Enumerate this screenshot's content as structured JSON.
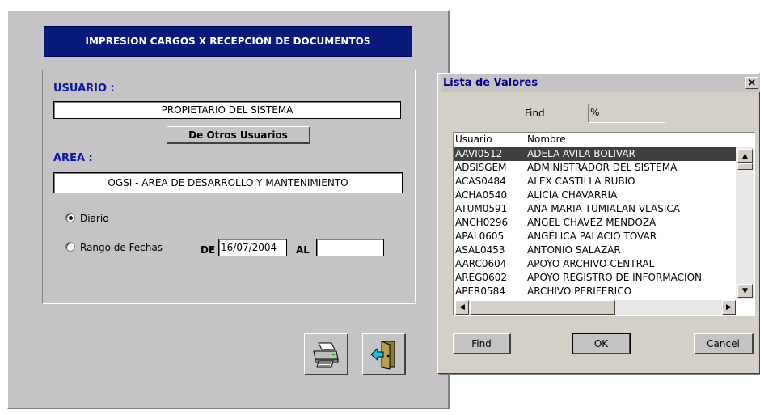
{
  "form": {
    "title": "IMPRESION CARGOS X RECEPCIÓN DE DOCUMENTOS",
    "usuario_label": "USUARIO :",
    "usuario_value": "PROPIETARIO DEL SISTEMA",
    "otros_usuarios_button": "De Otros Usuarios",
    "area_label": "AREA :",
    "area_value": "OGSI - AREA DE DESARROLLO Y MANTENIMIENTO",
    "radio_diario": "Diario",
    "radio_rango": "Rango de Fechas",
    "selected_radio": "Diario",
    "de_label": "DE",
    "de_value": "16/07/2004",
    "al_label": "AL",
    "al_value": ""
  },
  "icons": {
    "print": "printer-icon",
    "exit": "exit-door-icon"
  },
  "dialog": {
    "title": "Lista de Valores",
    "close": "×",
    "find_label": "Find",
    "find_value": "%",
    "col_usuario": "Usuario",
    "col_nombre": "Nombre",
    "rows": [
      {
        "usuario": "AAVI0512",
        "nombre": "ADELA AVILA BOLIVAR"
      },
      {
        "usuario": "ADSISGEM",
        "nombre": "ADMINISTRADOR DEL SISTEMA"
      },
      {
        "usuario": "ACAS0484",
        "nombre": "ALEX CASTILLA RUBIO"
      },
      {
        "usuario": "ACHA0540",
        "nombre": "ALICIA CHAVARRIA"
      },
      {
        "usuario": "ATUM0591",
        "nombre": "ANA MARIA TUMIALAN VLASICA"
      },
      {
        "usuario": "ANCH0296",
        "nombre": "ANGEL CHAVEZ MENDOZA"
      },
      {
        "usuario": "APAL0605",
        "nombre": "ANGÉLICA PALACIO TOVAR"
      },
      {
        "usuario": "ASAL0453",
        "nombre": "ANTONIO SALAZAR"
      },
      {
        "usuario": "AARC0604",
        "nombre": "APOYO ARCHIVO CENTRAL"
      },
      {
        "usuario": "AREG0602",
        "nombre": "APOYO REGISTRO DE INFORMACION"
      },
      {
        "usuario": "APER0584",
        "nombre": "ARCHIVO PERIFERICO"
      }
    ],
    "selected_index": 0,
    "find_button": "Find",
    "ok_button": "OK",
    "cancel_button": "Cancel"
  },
  "colors": {
    "title_bg": "#0a1a7a",
    "label_blue": "#0a1a9a",
    "selection_bg": "#404040"
  }
}
